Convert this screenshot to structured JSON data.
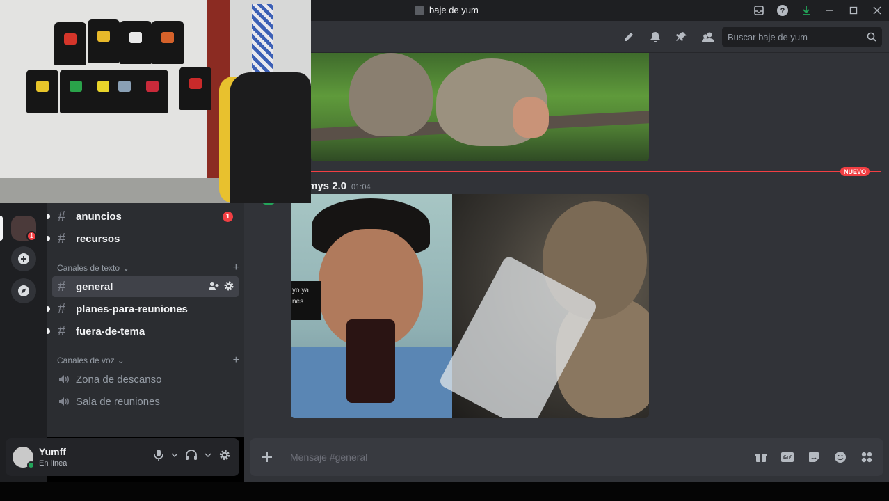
{
  "window": {
    "title": "baje de yum"
  },
  "search": {
    "placeholder": "Buscar baje de yum"
  },
  "titlebar_icons": [
    "inbox-icon",
    "help-icon",
    "download-icon",
    "minimize-icon",
    "maximize-icon",
    "close-icon"
  ],
  "header_icons": [
    "threads-icon",
    "bell-icon",
    "pin-icon",
    "members-icon"
  ],
  "divider": {
    "label": "NUEVO"
  },
  "message": {
    "author": "mys 2.0",
    "time": "01:04",
    "overlay_caption_line1": "yo ya",
    "overlay_caption_line2": "nes"
  },
  "server_rail": {
    "server_badge": "1",
    "add_icon": "+"
  },
  "channels": {
    "announcements": {
      "name": "anuncios",
      "badge": "1"
    },
    "resources": {
      "name": "recursos"
    },
    "text_category": "Canales de texto",
    "text": [
      {
        "name": "general",
        "selected": true
      },
      {
        "name": "planes-para-reuniones"
      },
      {
        "name": "fuera-de-tema"
      }
    ],
    "voice_category": "Canales de voz",
    "voice": [
      {
        "name": "Zona de descanso"
      },
      {
        "name": "Sala de reuniones"
      }
    ]
  },
  "user": {
    "name": "Yumff",
    "status": "En línea"
  },
  "composer": {
    "placeholder": "Mensaje #general"
  },
  "colors": {
    "accent_red": "#f23f43",
    "online_green": "#23a55a",
    "bg_chat": "#313338",
    "bg_sidebar": "#2b2d31"
  }
}
